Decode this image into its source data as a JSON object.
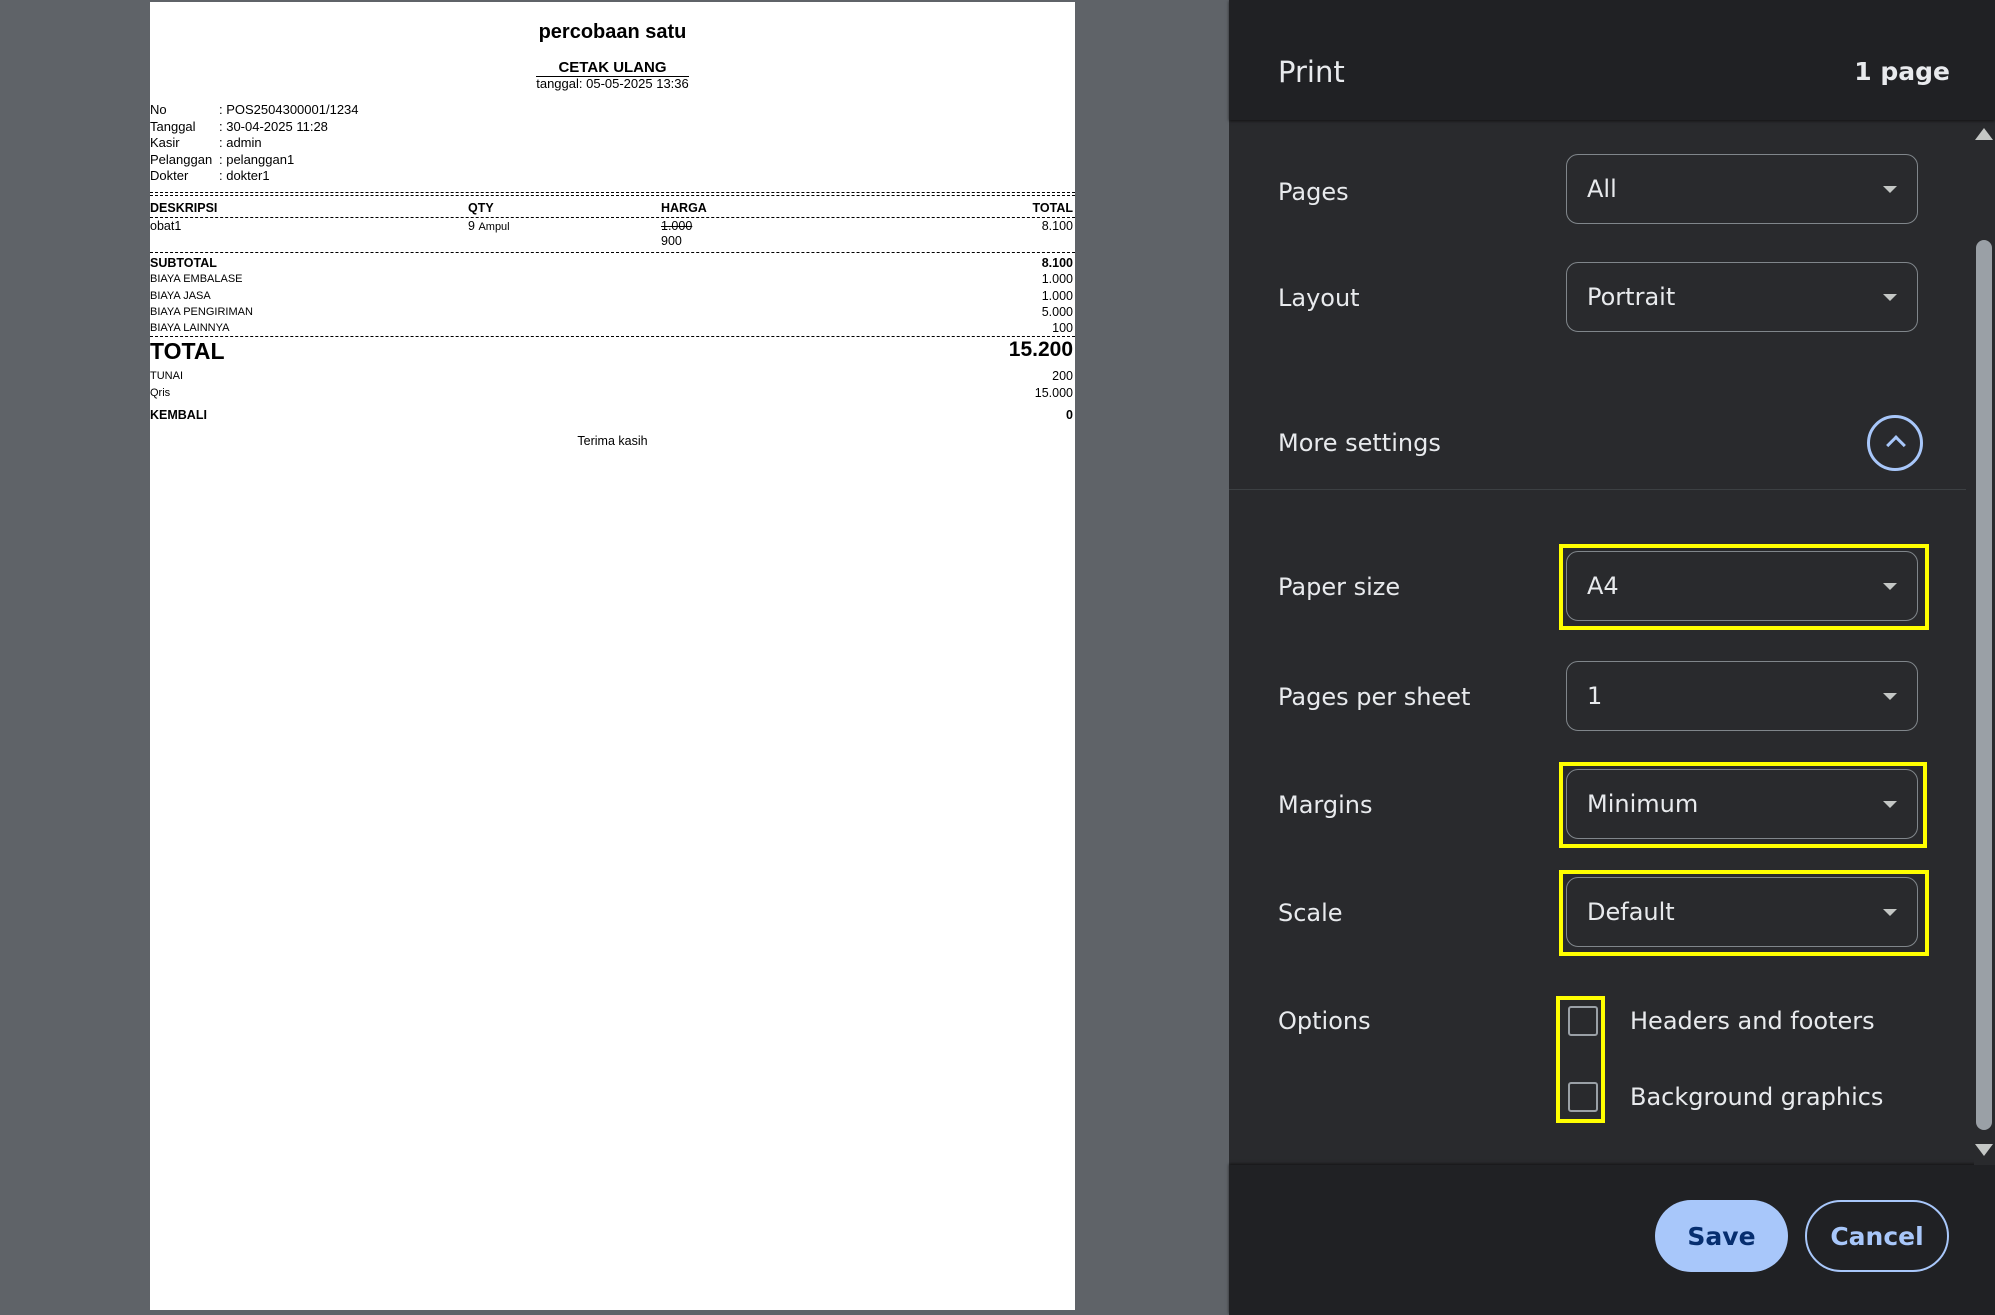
{
  "receipt": {
    "title": "percobaan satu",
    "reprint": "CETAK ULANG",
    "date_line": "tanggal: 05-05-2025 13:36",
    "info": [
      {
        "key": "No",
        "value": ": POS2504300001/1234"
      },
      {
        "key": "Tanggal",
        "value": ": 30-04-2025 11:28"
      },
      {
        "key": "Kasir",
        "value": ": admin"
      },
      {
        "key": "Pelanggan",
        "value": ": pelanggan1"
      },
      {
        "key": "Dokter",
        "value": ": dokter1"
      }
    ],
    "columns": {
      "desc": "DESKRIPSI",
      "qty": "QTY",
      "price": "HARGA",
      "total": "TOTAL"
    },
    "item": {
      "name": "obat1",
      "qty": "9",
      "unit": "Ampul",
      "price_old": "1.000",
      "price_new": "900",
      "total": "8.100"
    },
    "subtotal": {
      "label": "SUBTOTAL",
      "value": "8.100"
    },
    "fees": [
      {
        "label": "BIAYA EMBALASE",
        "value": "1.000"
      },
      {
        "label": "BIAYA JASA",
        "value": "1.000"
      },
      {
        "label": "BIAYA PENGIRIMAN",
        "value": "5.000"
      },
      {
        "label": "BIAYA LAINNYA",
        "value": "100"
      }
    ],
    "total": {
      "label": "TOTAL",
      "value": "15.200"
    },
    "payments": [
      {
        "label": "TUNAI",
        "value": "200"
      },
      {
        "label": "Qris",
        "value": "15.000"
      }
    ],
    "change": {
      "label": "KEMBALI",
      "value": "0"
    },
    "thanks": "Terima kasih"
  },
  "panel": {
    "title": "Print",
    "page_count": "1 page",
    "pages": {
      "label": "Pages",
      "value": "All"
    },
    "layout": {
      "label": "Layout",
      "value": "Portrait"
    },
    "more_settings": "More settings",
    "paper_size": {
      "label": "Paper size",
      "value": "A4"
    },
    "pages_per_sheet": {
      "label": "Pages per sheet",
      "value": "1"
    },
    "margins": {
      "label": "Margins",
      "value": "Minimum"
    },
    "scale": {
      "label": "Scale",
      "value": "Default"
    },
    "options": {
      "label": "Options",
      "headers_footers": "Headers and footers",
      "headers_footers_checked": false,
      "background_graphics": "Background graphics",
      "background_graphics_checked": false
    },
    "save": "Save",
    "cancel": "Cancel"
  },
  "colors": {
    "highlight": "#ffff00",
    "accent": "#a8c7fa",
    "panel_bg": "#292a2d",
    "preview_bg": "#5f6368"
  }
}
